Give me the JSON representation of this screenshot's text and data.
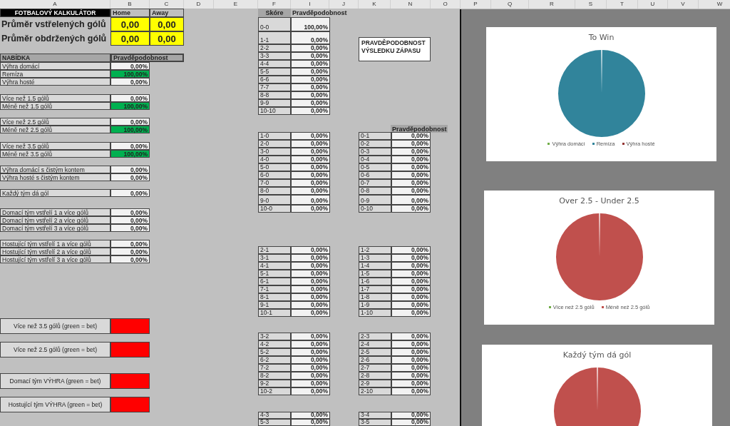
{
  "columns": [
    "A",
    "B",
    "C",
    "D",
    "E",
    "F",
    "I",
    "J",
    "K",
    "N",
    "O",
    "P",
    "Q",
    "R",
    "S",
    "T",
    "U",
    "V",
    "W"
  ],
  "calculator": {
    "title": "FOTBALOVÝ KALKULÁTOR",
    "home": "Home",
    "away": "Away",
    "averages": [
      {
        "label": "Průměr vstřelených gólů",
        "home": "0,00",
        "away": "0,00"
      },
      {
        "label": "Průměr obdržených gólů",
        "home": "0,00",
        "away": "0,00"
      }
    ]
  },
  "offer_header": {
    "label": "NABÍDKA",
    "probability": "Pravděpodobnost"
  },
  "markets": [
    {
      "items": [
        {
          "label": "Výhra domácí",
          "value": "0,00%",
          "highlighted": false
        },
        {
          "label": "Remíza",
          "value": "100,00%",
          "highlighted": true
        },
        {
          "label": "Výhra hosté",
          "value": "0,00%",
          "highlighted": false
        }
      ]
    },
    {
      "items": [
        {
          "label": "Více než 1.5 gólů",
          "value": "0,00%",
          "highlighted": false
        },
        {
          "label": "Méně než 1.5 gólů",
          "value": "100,00%",
          "highlighted": true
        }
      ]
    },
    {
      "items": [
        {
          "label": "Více než 2.5 gólů",
          "value": "0,00%",
          "highlighted": false
        },
        {
          "label": "Méně než 2.5 gólů",
          "value": "100,00%",
          "highlighted": true
        }
      ]
    },
    {
      "items": [
        {
          "label": "Více než 3.5 gólů",
          "value": "0,00%",
          "highlighted": false
        },
        {
          "label": "Méně než 3.5 gólů",
          "value": "100,00%",
          "highlighted": true
        }
      ]
    },
    {
      "items": [
        {
          "label": "Výhra domácí s čistým kontem",
          "value": "0,00%",
          "highlighted": false
        },
        {
          "label": "Výhra hosté s čistým kontem",
          "value": "0,00%",
          "highlighted": false
        }
      ]
    },
    {
      "items": [
        {
          "label": "Každý tým dá gól",
          "value": "0,00%",
          "highlighted": false
        }
      ]
    },
    {
      "items": [
        {
          "label": "Domací tým vstřelí 1 a více gólů",
          "value": "0,00%",
          "highlighted": false
        },
        {
          "label": "Domací tým vstřelí 2 a více gólů",
          "value": "0,00%",
          "highlighted": false
        },
        {
          "label": "Domací tým vstřelí 3 a více gólů",
          "value": "0,00%",
          "highlighted": false
        }
      ]
    },
    {
      "items": [
        {
          "label": "Hostující tým vstřelí 1 a více gólů",
          "value": "0,00%",
          "highlighted": false
        },
        {
          "label": "Hostující tým vstřelí 2 a více gólů",
          "value": "0,00%",
          "highlighted": false
        },
        {
          "label": "Hostující tým vstřelí 3 a více gólů",
          "value": "0,00%",
          "highlighted": false
        }
      ]
    }
  ],
  "bets": [
    {
      "label": "Více než 3.5 gólů (green = bet)",
      "bet": false
    },
    {
      "label": "Více než 2.5 gólů (green = bet)",
      "bet": false
    },
    {
      "label": "Domací tým VÝHRA (green = bet)",
      "bet": false
    },
    {
      "label": "Hostující tým VÝHRA (green = bet)",
      "bet": false
    }
  ],
  "draws": {
    "score_header": "Skóre",
    "probability_header": "Pravděpodobnost",
    "rows": [
      {
        "score": "0-0",
        "value": "100,00%"
      },
      {
        "score": "1-1",
        "value": "0,00%"
      },
      {
        "score": "2-2",
        "value": "0,00%"
      },
      {
        "score": "3-3",
        "value": "0,00%"
      },
      {
        "score": "4-4",
        "value": "0,00%"
      },
      {
        "score": "5-5",
        "value": "0,00%"
      },
      {
        "score": "6-6",
        "value": "0,00%"
      },
      {
        "score": "7-7",
        "value": "0,00%"
      },
      {
        "score": "8-8",
        "value": "0,00%"
      },
      {
        "score": "9-9",
        "value": "0,00%"
      },
      {
        "score": "10-10",
        "value": "0,00%"
      }
    ]
  },
  "result_box": "PRAVDĚPODOBNOST VÝSLEDKU ZÁPASU",
  "away_header": "Pravděpodobnost",
  "score_groups": [
    {
      "home": [
        {
          "score": "1-0",
          "value": "0,00%"
        },
        {
          "score": "2-0",
          "value": "0,00%"
        },
        {
          "score": "3-0",
          "value": "0,00%"
        },
        {
          "score": "4-0",
          "value": "0,00%"
        },
        {
          "score": "5-0",
          "value": "0,00%"
        },
        {
          "score": "6-0",
          "value": "0,00%"
        },
        {
          "score": "7-0",
          "value": "0,00%"
        },
        {
          "score": "8-0",
          "value": "0,00%"
        },
        {
          "score": "9-0",
          "value": "0,00%"
        },
        {
          "score": "10-0",
          "value": "0,00%"
        }
      ],
      "away": [
        {
          "score": "0-1",
          "value": "0,00%"
        },
        {
          "score": "0-2",
          "value": "0,00%"
        },
        {
          "score": "0-3",
          "value": "0,00%"
        },
        {
          "score": "0-4",
          "value": "0,00%"
        },
        {
          "score": "0-5",
          "value": "0,00%"
        },
        {
          "score": "0-6",
          "value": "0,00%"
        },
        {
          "score": "0-7",
          "value": "0,00%"
        },
        {
          "score": "0-8",
          "value": "0,00%"
        },
        {
          "score": "0-9",
          "value": "0,00%"
        },
        {
          "score": "0-10",
          "value": "0,00%"
        }
      ]
    },
    {
      "home": [
        {
          "score": "2-1",
          "value": "0,00%"
        },
        {
          "score": "3-1",
          "value": "0,00%"
        },
        {
          "score": "4-1",
          "value": "0,00%"
        },
        {
          "score": "5-1",
          "value": "0,00%"
        },
        {
          "score": "6-1",
          "value": "0,00%"
        },
        {
          "score": "7-1",
          "value": "0,00%"
        },
        {
          "score": "8-1",
          "value": "0,00%"
        },
        {
          "score": "9-1",
          "value": "0,00%"
        },
        {
          "score": "10-1",
          "value": "0,00%"
        }
      ],
      "away": [
        {
          "score": "1-2",
          "value": "0,00%"
        },
        {
          "score": "1-3",
          "value": "0,00%"
        },
        {
          "score": "1-4",
          "value": "0,00%"
        },
        {
          "score": "1-5",
          "value": "0,00%"
        },
        {
          "score": "1-6",
          "value": "0,00%"
        },
        {
          "score": "1-7",
          "value": "0,00%"
        },
        {
          "score": "1-8",
          "value": "0,00%"
        },
        {
          "score": "1-9",
          "value": "0,00%"
        },
        {
          "score": "1-10",
          "value": "0,00%"
        }
      ]
    },
    {
      "home": [
        {
          "score": "3-2",
          "value": "0,00%"
        },
        {
          "score": "4-2",
          "value": "0,00%"
        },
        {
          "score": "5-2",
          "value": "0,00%"
        },
        {
          "score": "6-2",
          "value": "0,00%"
        },
        {
          "score": "7-2",
          "value": "0,00%"
        },
        {
          "score": "8-2",
          "value": "0,00%"
        },
        {
          "score": "9-2",
          "value": "0,00%"
        },
        {
          "score": "10-2",
          "value": "0,00%"
        }
      ],
      "away": [
        {
          "score": "2-3",
          "value": "0,00%"
        },
        {
          "score": "2-4",
          "value": "0,00%"
        },
        {
          "score": "2-5",
          "value": "0,00%"
        },
        {
          "score": "2-6",
          "value": "0,00%"
        },
        {
          "score": "2-7",
          "value": "0,00%"
        },
        {
          "score": "2-8",
          "value": "0,00%"
        },
        {
          "score": "2-9",
          "value": "0,00%"
        },
        {
          "score": "2-10",
          "value": "0,00%"
        }
      ]
    },
    {
      "home": [
        {
          "score": "4-3",
          "value": "0,00%"
        },
        {
          "score": "5-3",
          "value": "0,00%"
        }
      ],
      "away": [
        {
          "score": "3-4",
          "value": "0,00%"
        },
        {
          "score": "3-5",
          "value": "0,00%"
        }
      ]
    }
  ],
  "charts": [
    {
      "slices": [
        {
          "color": "#70ad47"
        },
        {
          "color": "#31849b"
        },
        {
          "color": "#943634"
        }
      ],
      "chart_data": {
        "type": "pie",
        "title": "To Win",
        "categories": [
          "Výhra domácí",
          "Remíza",
          "Výhra hosté"
        ],
        "values": [
          0,
          100,
          0
        ]
      }
    },
    {
      "slices": [
        {
          "color": "#70ad47"
        },
        {
          "color": "#c0504d"
        }
      ],
      "chart_data": {
        "type": "pie",
        "title": "Over 2.5 - Under 2.5",
        "categories": [
          "Více než 2.5 gólů",
          "Méně než 2.5 gólů"
        ],
        "values": [
          0,
          100
        ]
      }
    },
    {
      "slices": [
        {
          "color": "#c0504d"
        }
      ],
      "chart_data": {
        "type": "pie",
        "title": "Každý tým dá gól",
        "values": [
          100
        ]
      }
    }
  ]
}
